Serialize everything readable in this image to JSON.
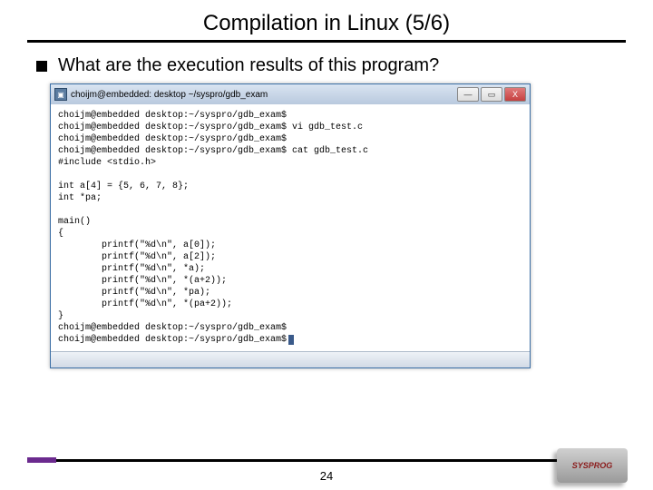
{
  "slide": {
    "title": "Compilation in Linux (5/6)",
    "bullet": "What are the execution results of this program?",
    "page_number": "24",
    "logo_text": "SYSPROG"
  },
  "window": {
    "title": "choijm@embedded: desktop ~/syspro/gdb_exam",
    "controls": {
      "min": "—",
      "max": "▭",
      "close": "X"
    }
  },
  "terminal": {
    "lines": [
      "choijm@embedded desktop:~/syspro/gdb_exam$",
      "choijm@embedded desktop:~/syspro/gdb_exam$ vi gdb_test.c",
      "choijm@embedded desktop:~/syspro/gdb_exam$",
      "choijm@embedded desktop:~/syspro/gdb_exam$ cat gdb_test.c",
      "#include <stdio.h>",
      "",
      "int a[4] = {5, 6, 7, 8};",
      "int *pa;",
      "",
      "main()",
      "{",
      "        printf(\"%d\\n\", a[0]);",
      "        printf(\"%d\\n\", a[2]);",
      "        printf(\"%d\\n\", *a);",
      "        printf(\"%d\\n\", *(a+2));",
      "        printf(\"%d\\n\", *pa);",
      "        printf(\"%d\\n\", *(pa+2));",
      "}",
      "choijm@embedded desktop:~/syspro/gdb_exam$",
      "choijm@embedded desktop:~/syspro/gdb_exam$"
    ]
  }
}
